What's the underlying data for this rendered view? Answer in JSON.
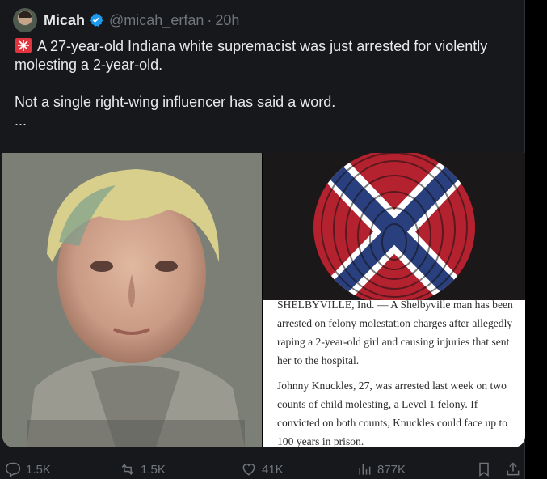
{
  "post": {
    "author_name": "Micah",
    "handle": "@micah_erfan",
    "separator": "·",
    "time": "20h",
    "text_line1": "A 27-year-old Indiana white supremacist was just arrested for violently molesting a 2-year-old.",
    "text_line2": "Not a single right-wing influencer has said a word.",
    "more": "...",
    "icons": {
      "siren": "siren-emoji-icon",
      "verified": "verified-badge-icon"
    }
  },
  "article": {
    "p1": "SHELBYVILLE, Ind. — A Shelbyville man has been arrested on felony molestation charges after allegedly raping a 2-year-old girl and causing injuries that sent her to the hospital.",
    "p2": "Johnny Knuckles, 27, was arrested last week on two counts of child molesting, a Level 1 felony. If convicted on both counts, Knuckles could face up to 100 years in prison."
  },
  "actions": {
    "replies": "1.5K",
    "reposts": "1.5K",
    "likes": "41K",
    "views": "877K"
  },
  "colors": {
    "background": "#000000",
    "card": "#16181c",
    "text": "#e7e9ea",
    "muted": "#71767b",
    "verified": "#1d9bf0"
  }
}
